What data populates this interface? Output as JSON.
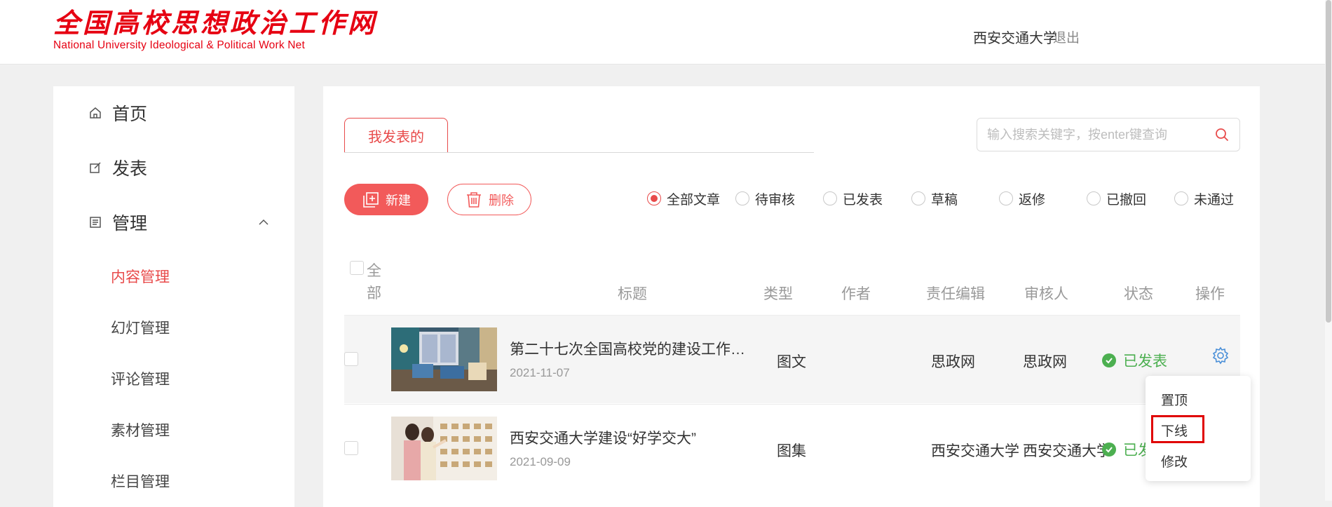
{
  "header": {
    "logo_cn": "全国高校思想政治工作网",
    "logo_en": "National University Ideological & Political Work Net",
    "user": "西安交通大学",
    "logout": "退出"
  },
  "sidebar": {
    "home": "首页",
    "publish": "发表",
    "manage": "管理",
    "sub_items": [
      "内容管理",
      "幻灯管理",
      "评论管理",
      "素材管理",
      "栏目管理"
    ]
  },
  "tabs": {
    "my_posts": "我发表的"
  },
  "search": {
    "placeholder": "输入搜索关键字，按enter键查询",
    "value": ""
  },
  "actions": {
    "new": "新建",
    "delete": "删除"
  },
  "filters": {
    "options": [
      "全部文章",
      "待审核",
      "已发表",
      "草稿",
      "返修",
      "已撤回",
      "未通过"
    ],
    "selected": "全部文章"
  },
  "table": {
    "select_all": "全部",
    "columns": {
      "title": "标题",
      "type": "类型",
      "author": "作者",
      "editor": "责任编辑",
      "reviewer": "审核人",
      "status": "状态",
      "action": "操作"
    },
    "rows": [
      {
        "title": "第二十七次全国高校党的建设工作…",
        "date": "2021-11-07",
        "type": "图文",
        "author": "",
        "editor": "思政网",
        "reviewer": "思政网",
        "status": "已发表"
      },
      {
        "title": "西安交通大学建设“好学交大”",
        "date": "2021-09-09",
        "type": "图集",
        "author": "",
        "editor": "西安交通大学",
        "reviewer": "西安交通大学",
        "status": "已发"
      }
    ]
  },
  "row_menu": {
    "items": [
      "置顶",
      "下线",
      "修改"
    ],
    "highlighted": "下线"
  },
  "colors": {
    "accent": "#e84a4a",
    "success": "#4caf50",
    "logo": "#e60012",
    "highlight_box": "#e00000"
  }
}
